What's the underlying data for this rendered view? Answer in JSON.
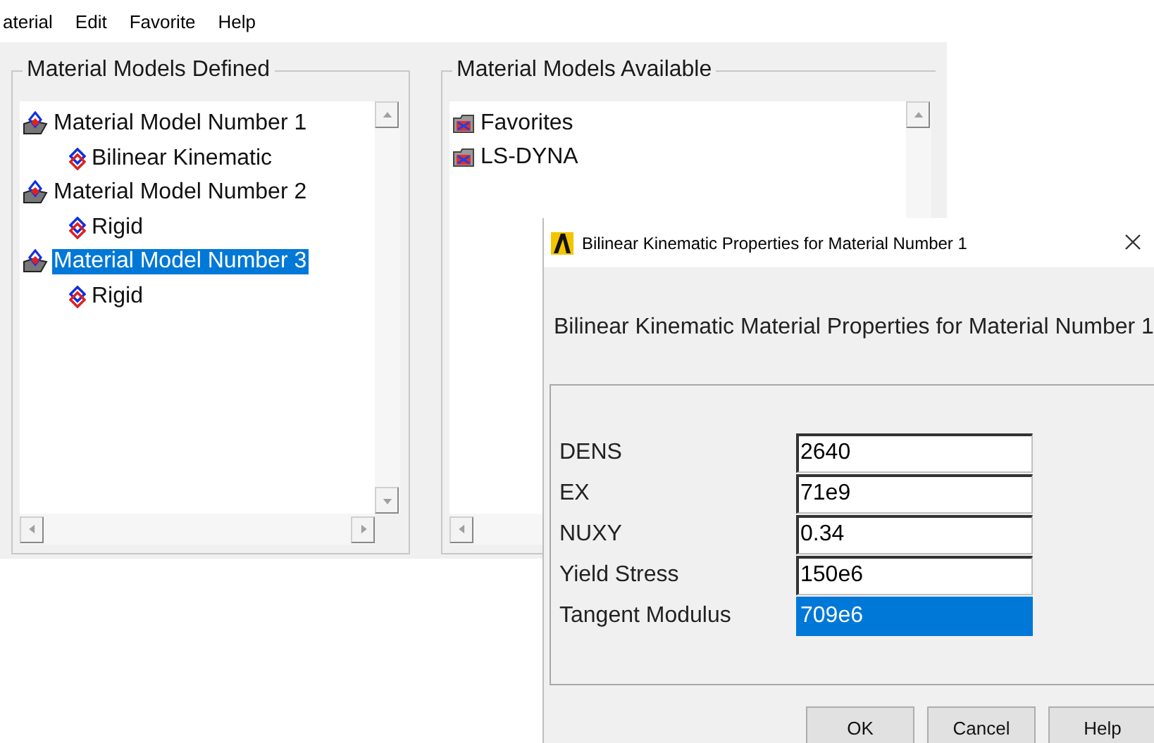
{
  "menu": [
    "aterial",
    "Edit",
    "Favorite",
    "Help"
  ],
  "defined": {
    "title": "Material Models Defined",
    "items": [
      {
        "label": "Material Model Number 1",
        "selected": false,
        "children": [
          {
            "label": "Bilinear Kinematic",
            "selected": false
          }
        ]
      },
      {
        "label": "Material Model Number 2",
        "selected": false,
        "children": [
          {
            "label": "Rigid",
            "selected": false
          }
        ]
      },
      {
        "label": "Material Model Number 3",
        "selected": true,
        "children": [
          {
            "label": "Rigid",
            "selected": false
          }
        ]
      }
    ]
  },
  "available": {
    "title": "Material Models Available",
    "items": [
      {
        "label": "Favorites"
      },
      {
        "label": "LS-DYNA"
      }
    ]
  },
  "dialog": {
    "title": "Bilinear Kinematic Properties for Material Number 1",
    "heading": "Bilinear Kinematic Material Properties for Material Number 1",
    "fields": [
      {
        "label": "DENS",
        "value": "2640",
        "selected": false
      },
      {
        "label": "EX",
        "value": "71e9",
        "selected": false
      },
      {
        "label": "NUXY",
        "value": "0.34",
        "selected": false
      },
      {
        "label": "Yield Stress",
        "value": "150e6",
        "selected": false
      },
      {
        "label": "Tangent Modulus",
        "value": "709e6",
        "selected": true
      }
    ],
    "buttons": [
      "OK",
      "Cancel",
      "Help"
    ]
  }
}
